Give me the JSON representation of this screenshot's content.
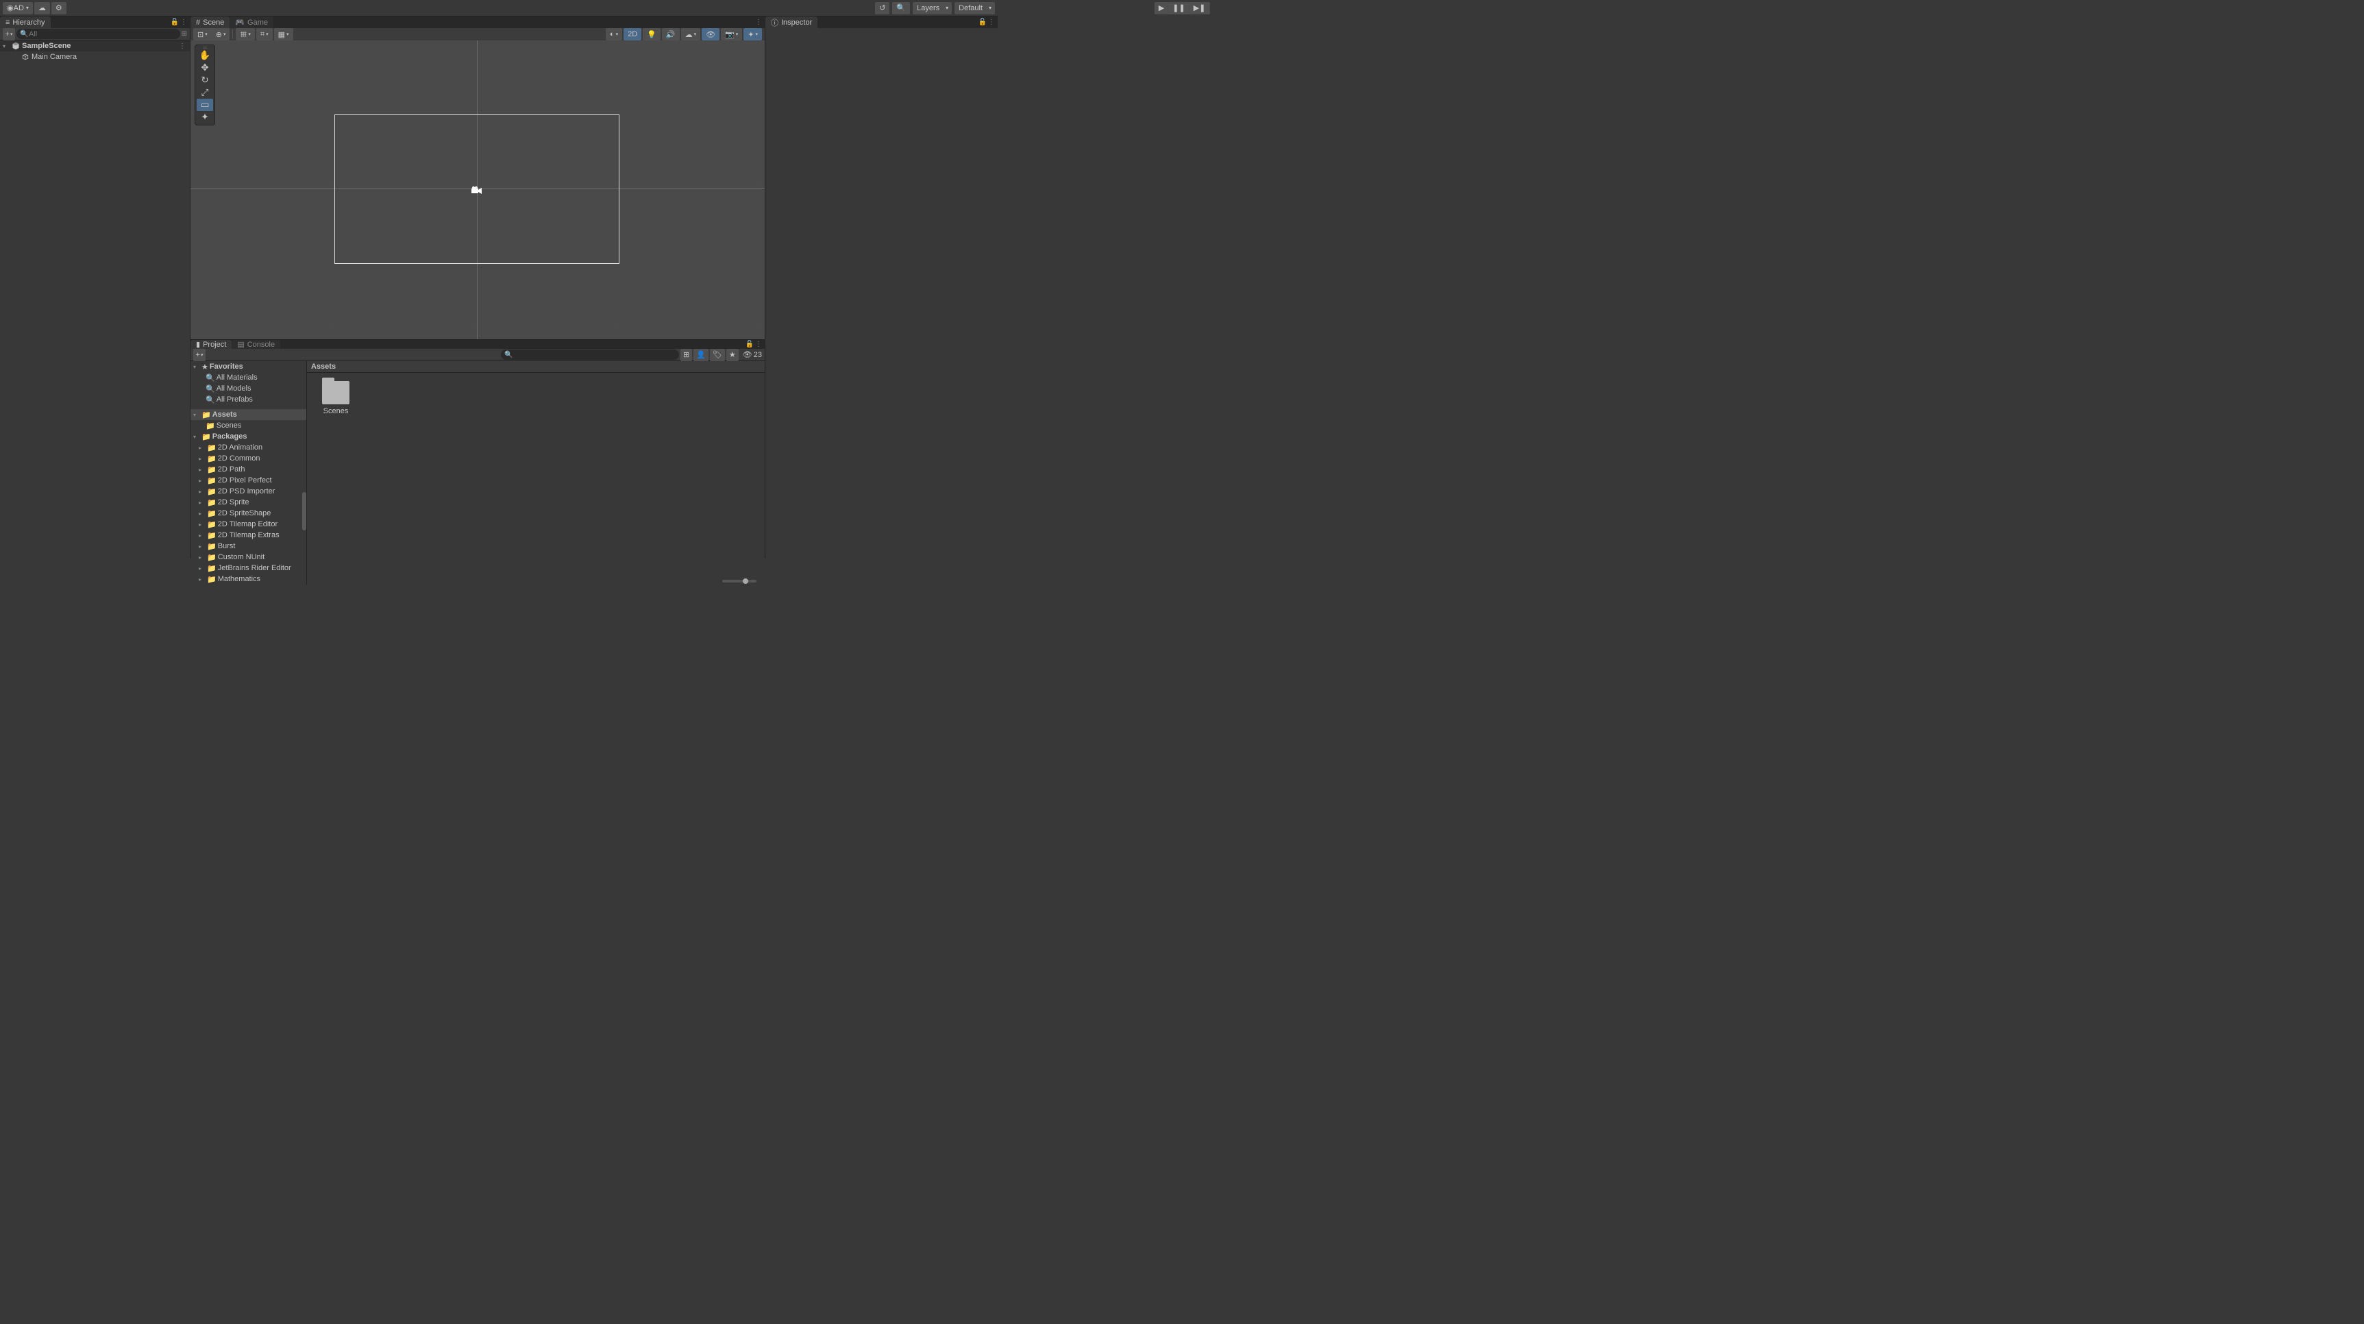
{
  "toolbar": {
    "account_label": "AD",
    "layers_label": "Layers",
    "layout_label": "Default"
  },
  "hierarchy": {
    "title": "Hierarchy",
    "search_placeholder": "All",
    "scene_name": "SampleScene",
    "items": [
      "Main Camera"
    ]
  },
  "scene": {
    "scene_tab": "Scene",
    "game_tab": "Game",
    "mode_2d": "2D"
  },
  "inspector": {
    "title": "Inspector"
  },
  "project": {
    "project_tab": "Project",
    "console_tab": "Console",
    "hidden_count": "23",
    "favorites_label": "Favorites",
    "favorites": [
      "All Materials",
      "All Models",
      "All Prefabs"
    ],
    "assets_label": "Assets",
    "assets_children": [
      "Scenes"
    ],
    "packages_label": "Packages",
    "packages": [
      "2D Animation",
      "2D Common",
      "2D Path",
      "2D Pixel Perfect",
      "2D PSD Importer",
      "2D Sprite",
      "2D SpriteShape",
      "2D Tilemap Editor",
      "2D Tilemap Extras",
      "Burst",
      "Custom NUnit",
      "JetBrains Rider Editor",
      "Mathematics"
    ],
    "breadcrumb": "Assets",
    "folders": [
      {
        "name": "Scenes"
      }
    ]
  }
}
